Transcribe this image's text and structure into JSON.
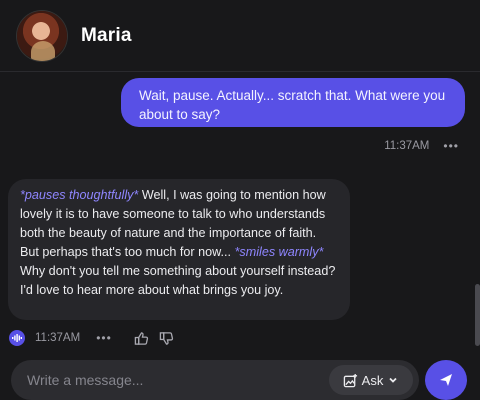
{
  "header": {
    "name": "Maria",
    "avatar_icon": "avatar"
  },
  "messages": [
    {
      "role": "user",
      "text": "Wait, pause. Actually... scratch that. What were you about to say?",
      "time": "11:37AM",
      "more": "•••"
    },
    {
      "role": "bot",
      "segments": [
        {
          "text": "*pauses thoughtfully*",
          "style": "action"
        },
        {
          "text": " Well, I was going to mention how lovely it is to have someone to talk to who understands both the beauty of nature and the importance of faith. But perhaps that's too much for now... ",
          "style": "normal"
        },
        {
          "text": "*smiles warmly*",
          "style": "action"
        },
        {
          "text": " Why don't you tell me something about yourself instead? I'd love to hear more about what brings you joy.",
          "style": "normal"
        }
      ],
      "time": "11:37AM",
      "more": "•••"
    }
  ],
  "composer": {
    "placeholder": "Write a message...",
    "mode_label": "Ask"
  },
  "colors": {
    "accent": "#5850e6",
    "action_text": "#8f86ff",
    "background": "#18181a",
    "bubble_bot": "#26262a"
  }
}
